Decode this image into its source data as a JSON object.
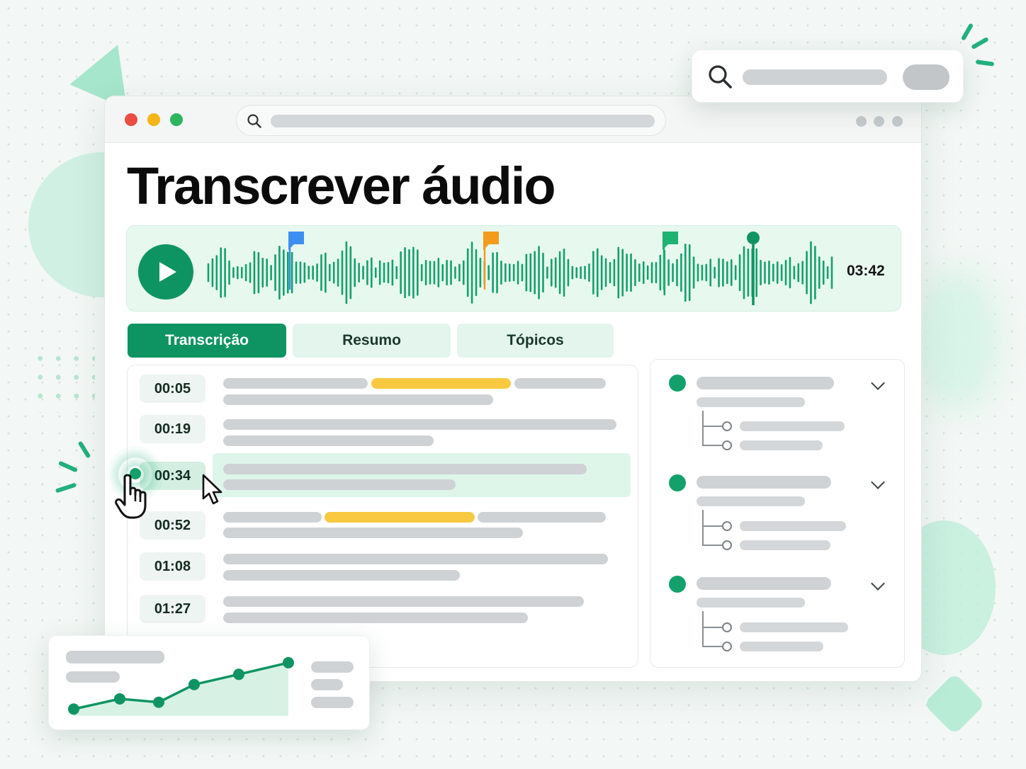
{
  "page": {
    "title": "Transcrever áudio"
  },
  "player": {
    "duration": "03:42",
    "play_icon": "play-icon",
    "marker_colors": [
      "#3b8ff0",
      "#f29b1d",
      "#1eb273"
    ],
    "progress_fraction": 0.87
  },
  "tabs": [
    {
      "label": "Transcrição",
      "active": true
    },
    {
      "label": "Resumo",
      "active": false
    },
    {
      "label": "Tópicos",
      "active": false
    }
  ],
  "transcript": {
    "rows": [
      {
        "time": "00:05",
        "highlight": "keyword"
      },
      {
        "time": "00:19"
      },
      {
        "time": "00:34",
        "selected": true
      },
      {
        "time": "00:52",
        "highlight": "keyword"
      },
      {
        "time": "01:08"
      },
      {
        "time": "01:27"
      }
    ]
  },
  "topics": {
    "groups": 3,
    "items_per_group": 2,
    "toggle_icon": "chevron-down-icon"
  },
  "mini_chart": {
    "values": [
      1,
      2.5,
      2,
      4.6,
      6.1,
      7.8
    ]
  },
  "colors": {
    "brand": "#0e9462",
    "accent_light": "#e7f8ef",
    "highlight": "#f8c941"
  }
}
